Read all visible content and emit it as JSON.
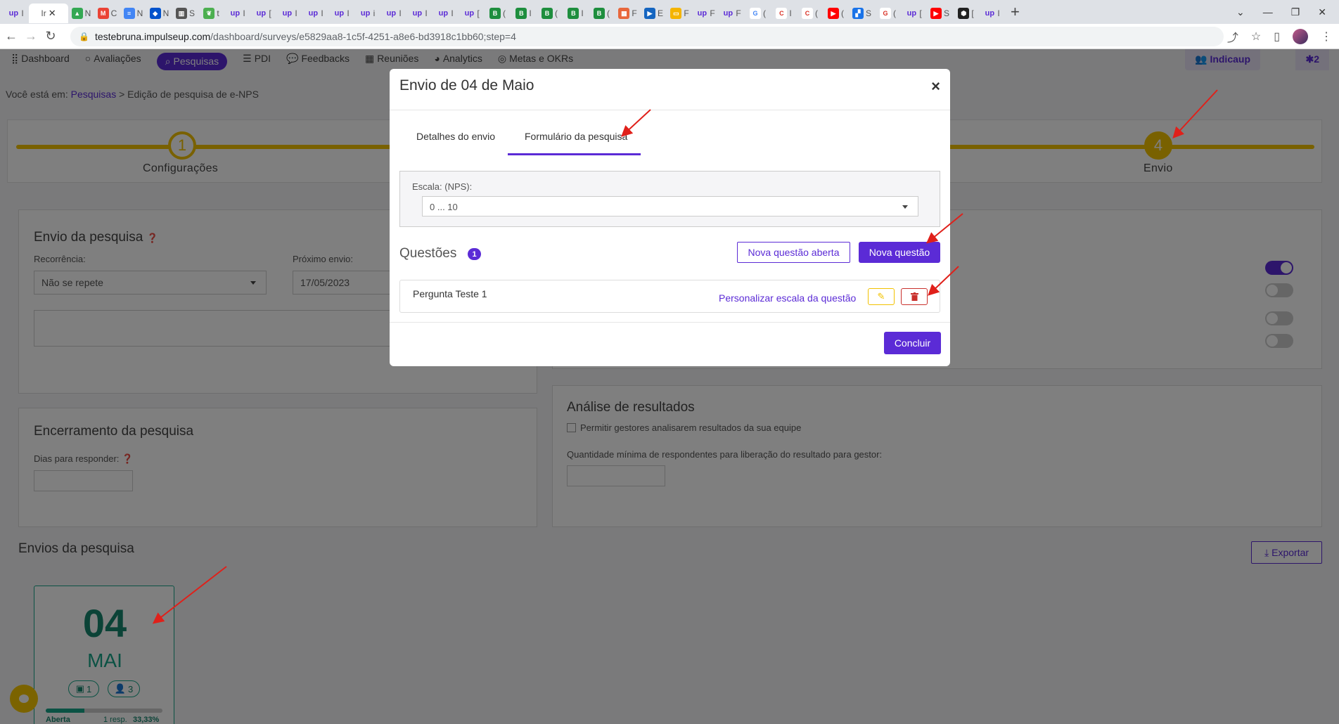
{
  "browser": {
    "active_tab_title": "Ir",
    "tabs": [
      {
        "fav": "up",
        "title": "I"
      },
      {
        "fav": "drive",
        "title": "N"
      },
      {
        "fav": "gmail",
        "title": "C"
      },
      {
        "fav": "docs",
        "title": "N"
      },
      {
        "fav": "jira",
        "title": "N"
      },
      {
        "fav": "chart",
        "title": "S"
      },
      {
        "fav": "leaf",
        "title": "t"
      },
      {
        "fav": "up",
        "title": "I"
      },
      {
        "fav": "up",
        "title": "["
      },
      {
        "fav": "up",
        "title": "I"
      },
      {
        "fav": "up",
        "title": "I"
      },
      {
        "fav": "up",
        "title": "I"
      },
      {
        "fav": "up",
        "title": "i"
      },
      {
        "fav": "up",
        "title": "I"
      },
      {
        "fav": "up",
        "title": "I"
      },
      {
        "fav": "up",
        "title": "I"
      },
      {
        "fav": "up",
        "title": "["
      },
      {
        "fav": "B",
        "title": "("
      },
      {
        "fav": "B",
        "title": "I"
      },
      {
        "fav": "B",
        "title": "("
      },
      {
        "fav": "B",
        "title": "I"
      },
      {
        "fav": "B",
        "title": "("
      },
      {
        "fav": "store",
        "title": "F"
      },
      {
        "fav": "play",
        "title": "E"
      },
      {
        "fav": "slides",
        "title": "F"
      },
      {
        "fav": "up",
        "title": "F"
      },
      {
        "fav": "up",
        "title": "F"
      },
      {
        "fav": "google",
        "title": "("
      },
      {
        "fav": "C",
        "title": "I"
      },
      {
        "fav": "C",
        "title": "("
      },
      {
        "fav": "yt",
        "title": "("
      },
      {
        "fav": "sq",
        "title": "S"
      },
      {
        "fav": "G",
        "title": "("
      },
      {
        "fav": "up",
        "title": "["
      },
      {
        "fav": "yt",
        "title": "S"
      },
      {
        "fav": "hex",
        "title": "["
      },
      {
        "fav": "up",
        "title": "I"
      }
    ],
    "url_host": "testebruna.impulseup.com",
    "url_path": "/dashboard/surveys/e5829aa8-1c5f-4251-a8e6-bd3918c1bb60;step=4"
  },
  "nav": {
    "items": [
      "Dashboard",
      "Avaliações",
      "Pesquisas",
      "PDI",
      "Feedbacks",
      "Reuniões",
      "Analytics",
      "Metas e OKRs"
    ],
    "active": "Pesquisas",
    "company": "Indicaup",
    "notif_count": "2"
  },
  "breadcrumb": {
    "prefix": "Você está em:",
    "link": "Pesquisas",
    "current": "> Edição de pesquisa de e-NPS"
  },
  "stepper": {
    "steps": [
      {
        "num": "1",
        "label": "Configurações"
      },
      {
        "num": "4",
        "label": "Envio"
      }
    ]
  },
  "envio_card": {
    "title": "Envio da pesquisa",
    "recorrencia_label": "Recorrência:",
    "recorrencia_value": "Não se repete",
    "proximo_label": "Próximo envio:",
    "proximo_value": "17/05/2023"
  },
  "encerramento_card": {
    "title": "Encerramento da pesquisa",
    "dias_label": "Dias para responder:"
  },
  "analise_card": {
    "title": "Análise de resultados",
    "checkbox_label": "Permitir gestores analisarem resultados da sua equipe",
    "min_label": "Quantidade mínima de respondentes para liberação do resultado para gestor:"
  },
  "envios": {
    "title": "Envios da pesquisa",
    "export_label": "Exportar",
    "card": {
      "day": "04",
      "month": "MAI",
      "comments": "1",
      "people": "3",
      "progress": 0.3333,
      "status": "Aberta",
      "resp": "1 resp.",
      "percent": "33,33%"
    }
  },
  "toggles": [
    true,
    false,
    false,
    false
  ],
  "modal": {
    "title": "Envio de 04 de Maio",
    "close": "×",
    "tabs": [
      "Detalhes do envio",
      "Formulário da pesquisa"
    ],
    "active_tab": "Formulário da pesquisa",
    "scale_label": "Escala: (NPS):",
    "scale_value": "0 ... 10",
    "questions_title": "Questões",
    "questions_count": "1",
    "btn_open_question": "Nova questão aberta",
    "btn_new_question": "Nova questão",
    "questions": [
      {
        "text": "Pergunta Teste 1",
        "customize": "Personalizar escala da questão"
      }
    ],
    "conclude": "Concluir"
  },
  "colors": {
    "primary": "#5b2bd6",
    "step": "#f2c200",
    "success": "#17a589",
    "danger": "#c9302c",
    "annotation": "#e0201a"
  }
}
